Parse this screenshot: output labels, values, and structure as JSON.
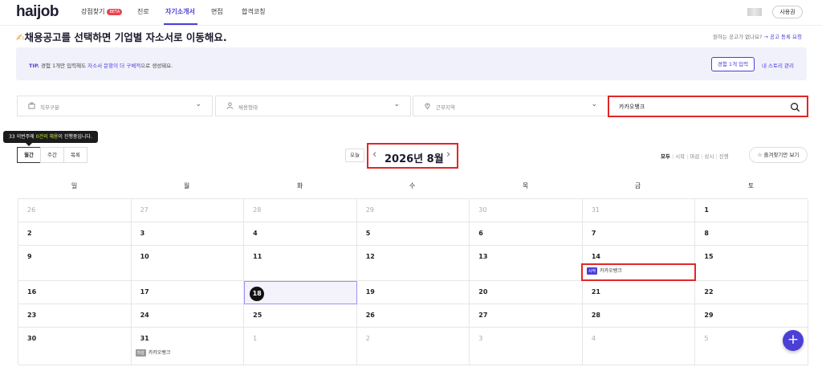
{
  "nav": {
    "logo": "haijob",
    "items": [
      {
        "label": "강점찾기",
        "badge": "BETA"
      },
      {
        "label": "진로"
      },
      {
        "label": "자기소개서",
        "active": true
      },
      {
        "label": "면접"
      },
      {
        "label": "합격코칭"
      }
    ],
    "user_button": "사용권"
  },
  "headline": {
    "emoji": "✍",
    "text": "채용공고를 선택하면 기업별 자소서로 이동해요.",
    "right_text": "원하는 공고가 없나요?",
    "right_link": "→ 공고 등록 요청"
  },
  "tip": {
    "label": "TIP.",
    "text_before": "경험 1개만 입력해도",
    "accent": "자소서 문항이 더 구체적",
    "text_after": "으로 생성돼요.",
    "button": "경험 1개 입력",
    "link": "내 스토리 관리"
  },
  "filters": [
    {
      "placeholder": "직무구분",
      "icon": "briefcase-icon"
    },
    {
      "placeholder": "채용형태",
      "icon": "person-icon"
    },
    {
      "placeholder": "근무지역",
      "icon": "location-pin-icon"
    }
  ],
  "search": {
    "value": "카카오뱅크"
  },
  "tooltip": {
    "count": "33",
    "text_before": "이번주에",
    "highlight": "0건의 채용",
    "text_after": "이 진행중입니다."
  },
  "views": [
    "월간",
    "주간",
    "목록"
  ],
  "calendar": {
    "today_label": "오늘",
    "title": "2026년 8월",
    "filters": [
      "모두",
      "시작",
      "마감",
      "상시",
      "진행"
    ],
    "favorite_label": "즐겨찾기만 보기",
    "weekdays": [
      "일",
      "월",
      "화",
      "수",
      "목",
      "금",
      "토"
    ],
    "weeks": [
      [
        {
          "d": "26",
          "o": true
        },
        {
          "d": "27",
          "o": true
        },
        {
          "d": "28",
          "o": true
        },
        {
          "d": "29",
          "o": true
        },
        {
          "d": "30",
          "o": true
        },
        {
          "d": "31",
          "o": true
        },
        {
          "d": "1"
        }
      ],
      [
        {
          "d": "2"
        },
        {
          "d": "3"
        },
        {
          "d": "4"
        },
        {
          "d": "5"
        },
        {
          "d": "6"
        },
        {
          "d": "7"
        },
        {
          "d": "8"
        }
      ],
      [
        {
          "d": "9"
        },
        {
          "d": "10"
        },
        {
          "d": "11"
        },
        {
          "d": "12"
        },
        {
          "d": "13"
        },
        {
          "d": "14",
          "event": {
            "tag": "시작",
            "kind": "start",
            "name": "카카오뱅크"
          }
        },
        {
          "d": "15"
        }
      ],
      [
        {
          "d": "16"
        },
        {
          "d": "17"
        },
        {
          "d": "18",
          "today": true
        },
        {
          "d": "19"
        },
        {
          "d": "20"
        },
        {
          "d": "21"
        },
        {
          "d": "22"
        }
      ],
      [
        {
          "d": "23"
        },
        {
          "d": "24"
        },
        {
          "d": "25"
        },
        {
          "d": "26"
        },
        {
          "d": "27"
        },
        {
          "d": "28"
        },
        {
          "d": "29"
        }
      ],
      [
        {
          "d": "30"
        },
        {
          "d": "31",
          "event": {
            "tag": "마감",
            "kind": "end",
            "name": "카카오뱅크"
          }
        },
        {
          "d": "1",
          "o": true
        },
        {
          "d": "2",
          "o": true
        },
        {
          "d": "3",
          "o": true
        },
        {
          "d": "4",
          "o": true
        },
        {
          "d": "5",
          "o": true
        }
      ]
    ]
  },
  "fab_label": "+"
}
